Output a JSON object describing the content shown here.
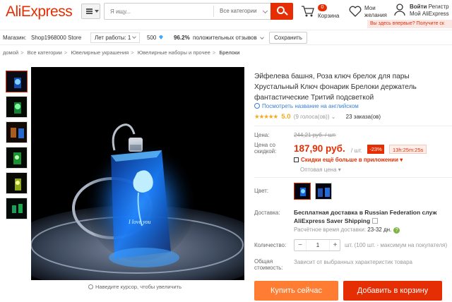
{
  "header": {
    "logo": "AliExpress",
    "search_placeholder": "Я ищу...",
    "search_category": "Все категории",
    "cart_count": "0",
    "cart_label": "Корзина",
    "wishlist_line1": "Мои",
    "wishlist_line2": "желания",
    "account_login": "Войти",
    "account_register": "Регистр",
    "account_line2": "Мой AliExpress",
    "new_user_banner": "Вы здесь впервые? Получите ск"
  },
  "store": {
    "label": "Магазин:",
    "name": "Shop1968000 Store",
    "years": "Лет работы: 1",
    "score": "500",
    "feedback_pct": "96.2%",
    "feedback_label": "положительных отзывов",
    "save_label": "Сохранить"
  },
  "breadcrumb": [
    "домой",
    "Все категории",
    "Ювелирные украшения",
    "Ювелирные наборы и прочее",
    "Брелоки"
  ],
  "gallery": {
    "zoom_hint": "Наведите курсор, чтобы увеличить",
    "thumb_glow_colors": [
      "#2a8fff",
      "#33ff66",
      "#ffaa44",
      "#44ff55",
      "#eaff55",
      "#66ffaa"
    ]
  },
  "product": {
    "title": "Эйфелева башня, Роза ключ брелок для пары Хрустальный Ключ фонарик Брелоки держатель фантастические Тритий подсветкой",
    "translate_link": "Посмотреть название на английском",
    "rating": "5.0",
    "votes": "(9 голоса(ов))",
    "orders": "23 заказа(ов)",
    "price_label": "Цена:",
    "old_price": "244,21 руб. / шт.",
    "discount_price_label_1": "Цена со",
    "discount_price_label_2": "скидкой:",
    "price": "187,90 руб.",
    "price_unit": "/ шт.",
    "discount": "-23%",
    "timer": "13h:25m:25s",
    "app_promo": "Скидки ещё больше в приложении",
    "wholesale": "Оптовая цена",
    "color_label": "Цвет:",
    "shipping_label": "Доставка:",
    "shipping_title": "Бесплатная доставка в Russian Federation служ",
    "shipping_method": "AliExpress Saver Shipping",
    "shipping_time_label": "Расчётное время доставки:",
    "shipping_time": "23-32 дн.",
    "quantity_label": "Количество:",
    "quantity": "1",
    "quantity_note": "шт. (100 шт. - максимум на покупателя)",
    "total_label_1": "Общая",
    "total_label_2": "стоимость:",
    "total_value": "Зависит от выбранных характеристик товара",
    "buy_now": "Купить сейчас",
    "add_to_cart": "Добавить в корзину"
  },
  "colors": {
    "brand": "#e62e04",
    "buy_orange": "#fe7d33",
    "star": "#f7a81b",
    "link": "#3a7fd5"
  }
}
